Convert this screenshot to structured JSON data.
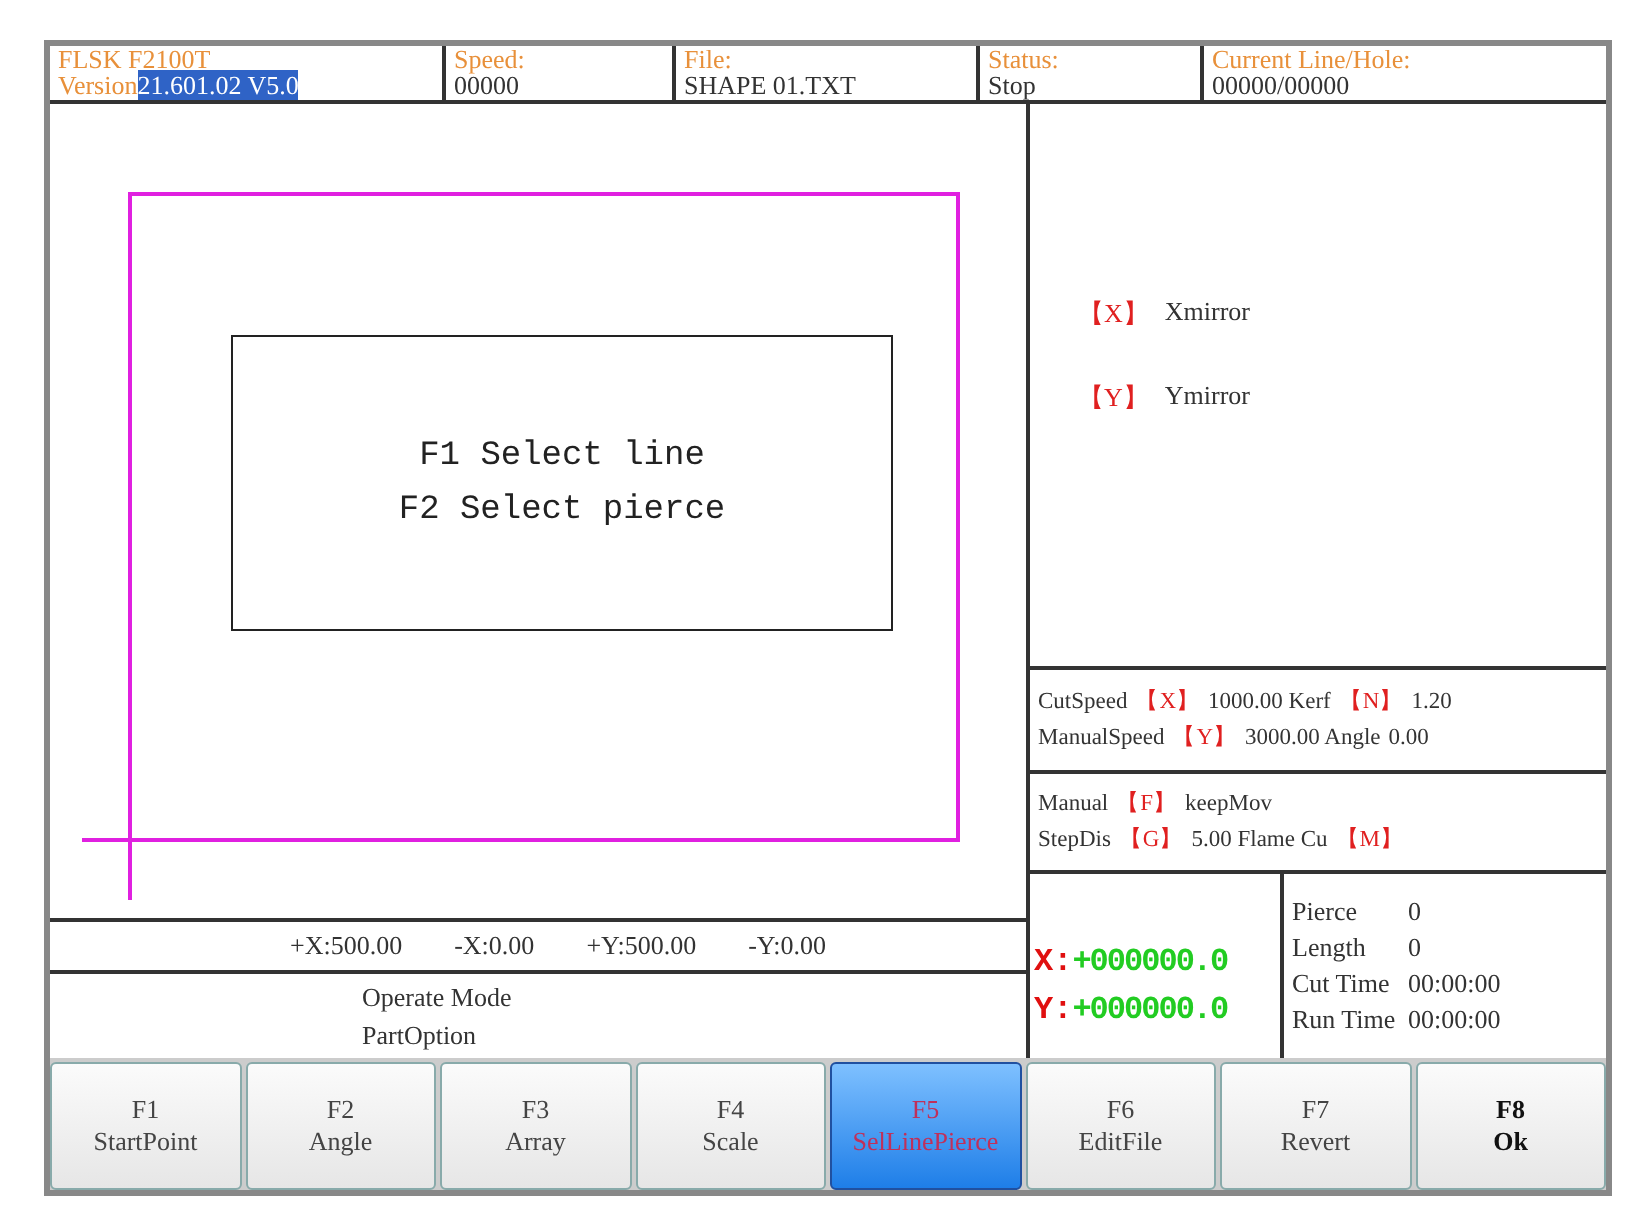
{
  "header": [
    {
      "label": "FLSK F2100T",
      "prefix": "Version",
      "value": "21.601.02 V5.0",
      "highlighted": true
    },
    {
      "label": "Speed:",
      "value": "00000",
      "highlighted": false
    },
    {
      "label": "File:",
      "value": "SHAPE 01.TXT",
      "highlighted": false
    },
    {
      "label": "Status:",
      "value": "Stop",
      "highlighted": false
    },
    {
      "label": "Current Line/Hole:",
      "value": "00000/00000",
      "highlighted": false
    }
  ],
  "canvas": {
    "prompts": [
      {
        "key": "F1",
        "label": "Select line"
      },
      {
        "key": "F2",
        "label": "Select pierce"
      }
    ]
  },
  "limits": [
    "+X:500.00",
    "-X:0.00",
    "+Y:500.00",
    "-Y:0.00"
  ],
  "mode": {
    "title": "Operate Mode",
    "value": "PartOption"
  },
  "mirror_options": [
    {
      "key": "【X】",
      "label": "Xmirror"
    },
    {
      "key": "【Y】",
      "label": "Ymirror"
    }
  ],
  "parameters": [
    [
      {
        "kind": "text",
        "text": "CutSpeed"
      },
      {
        "kind": "key",
        "text": "【X】"
      },
      {
        "kind": "text",
        "text": "1000.00 Kerf"
      },
      {
        "kind": "key",
        "text": "【N】"
      },
      {
        "kind": "text",
        "text": "1.20"
      }
    ],
    [
      {
        "kind": "text",
        "text": "ManualSpeed"
      },
      {
        "kind": "key",
        "text": "【Y】"
      },
      {
        "kind": "text",
        "text": "3000.00 Angle"
      },
      {
        "kind": "text",
        "text": "0.00"
      }
    ]
  ],
  "manual": [
    [
      {
        "kind": "text",
        "text": "Manual"
      },
      {
        "kind": "key",
        "text": "【F】"
      },
      {
        "kind": "text",
        "text": "keepMov"
      }
    ],
    [
      {
        "kind": "text",
        "text": "StepDis"
      },
      {
        "kind": "key",
        "text": "【G】"
      },
      {
        "kind": "text",
        "text": "5.00 Flame Cu"
      },
      {
        "kind": "key",
        "text": "【M】"
      }
    ]
  ],
  "position": [
    {
      "axis": "X:",
      "value": "+000000.0"
    },
    {
      "axis": "Y:",
      "value": "+000000.0"
    }
  ],
  "stats": [
    {
      "name": "Pierce",
      "value": "0"
    },
    {
      "name": "Length",
      "value": "0"
    },
    {
      "name": "Cut Time",
      "value": "00:00:00"
    },
    {
      "name": "Run Time",
      "value": "00:00:00"
    }
  ],
  "function_keys": [
    {
      "key": "F1",
      "label": "StartPoint",
      "selected": false,
      "bold": false
    },
    {
      "key": "F2",
      "label": "Angle",
      "selected": false,
      "bold": false
    },
    {
      "key": "F3",
      "label": "Array",
      "selected": false,
      "bold": false
    },
    {
      "key": "F4",
      "label": "Scale",
      "selected": false,
      "bold": false
    },
    {
      "key": "F5",
      "label": "SelLinePierce",
      "selected": true,
      "bold": false
    },
    {
      "key": "F6",
      "label": "EditFile",
      "selected": false,
      "bold": false
    },
    {
      "key": "F7",
      "label": "Revert",
      "selected": false,
      "bold": false
    },
    {
      "key": "F8",
      "label": "Ok",
      "selected": false,
      "bold": true
    }
  ]
}
